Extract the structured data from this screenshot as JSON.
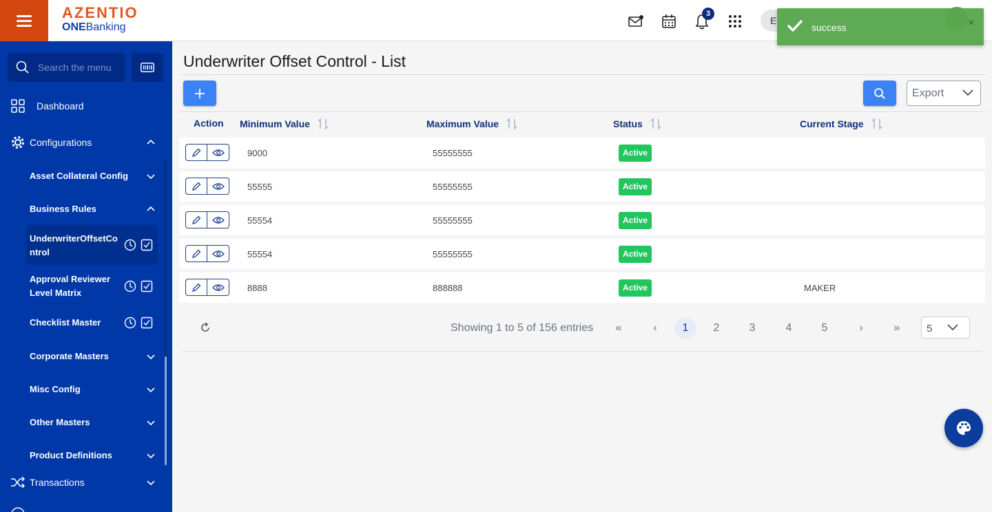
{
  "app": {
    "brand": "AZENTIO",
    "sub_brand_bold": "ONE",
    "sub_brand_rest": "Banking",
    "notification_count": "3",
    "user_initial": "E"
  },
  "toast": {
    "message": "success",
    "close": "×"
  },
  "sidebar": {
    "search_placeholder": "Search the menu",
    "dashboard": "Dashboard",
    "configurations": "Configurations",
    "asset_collateral": "Asset Collateral Config",
    "business_rules": "Business Rules",
    "underwriter_line1": "UnderwriterOffsetCo",
    "underwriter_line2": "ntrol",
    "approval_line1": "Approval Reviewer",
    "approval_line2": "Level Matrix",
    "checklist": "Checklist Master",
    "corporate": "Corporate Masters",
    "misc": "Misc Config",
    "other": "Other Masters",
    "product": "Product Definitions",
    "transactions": "Transactions"
  },
  "page": {
    "title": "Underwriter Offset Control - List",
    "export_label": "Export"
  },
  "table": {
    "headers": {
      "action": "Action",
      "min": "Minimum Value",
      "max": "Maximum Value",
      "status": "Status",
      "stage": "Current Stage"
    },
    "rows": [
      {
        "min": "9000",
        "max": "55555555",
        "status": "Active",
        "stage": ""
      },
      {
        "min": "55555",
        "max": "55555555",
        "status": "Active",
        "stage": ""
      },
      {
        "min": "55554",
        "max": "55555555",
        "status": "Active",
        "stage": ""
      },
      {
        "min": "55554",
        "max": "55555555",
        "status": "Active",
        "stage": ""
      },
      {
        "min": "8888",
        "max": "888888",
        "status": "Active",
        "stage": "MAKER"
      }
    ]
  },
  "pagination": {
    "summary": "Showing 1 to 5 of 156 entries",
    "pages": [
      "1",
      "2",
      "3",
      "4",
      "5"
    ],
    "first": "«",
    "prev": "‹",
    "next": "›",
    "last": "»",
    "page_size": "5"
  },
  "colors": {
    "sidebar": "#0038a8",
    "accent": "#3b82f6",
    "brand_orange": "#d4470f",
    "status_active": "#22c55e",
    "toast": "#5aa84f"
  }
}
